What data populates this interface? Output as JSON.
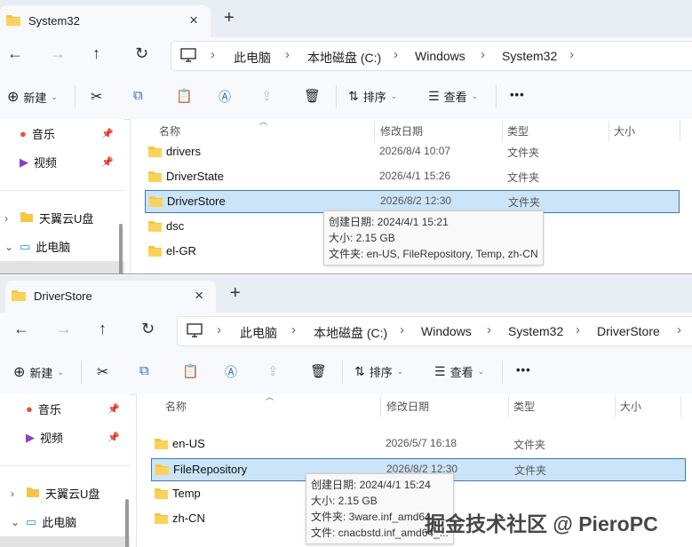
{
  "window1": {
    "tab_title": "System32",
    "tab_close": "×",
    "new_tab": "+",
    "breadcrumb": [
      "此电脑",
      "本地磁盘 (C:)",
      "Windows",
      "System32"
    ],
    "toolbar": {
      "new": "新建",
      "sort": "排序",
      "view": "查看",
      "more": "•••"
    },
    "sidebar": [
      {
        "label": "音乐",
        "icon": "music-icon",
        "pinned": true
      },
      {
        "label": "视频",
        "icon": "video-icon",
        "pinned": true
      },
      {
        "label": "天翼云U盘",
        "icon": "folder-icon",
        "expandable": true
      },
      {
        "label": "此电脑",
        "icon": "computer-icon",
        "expandable": true,
        "expanded": true
      }
    ],
    "columns": {
      "name": "名称",
      "modified": "修改日期",
      "type": "类型",
      "size": "大小"
    },
    "rows": [
      {
        "name": "drivers",
        "date": "2026/8/4 10:07",
        "type": "文件夹"
      },
      {
        "name": "DriverState",
        "date": "2026/4/1 15:26",
        "type": "文件夹"
      },
      {
        "name": "DriverStore",
        "date": "2026/8/2 12:30",
        "type": "文件夹",
        "selected": true
      },
      {
        "name": "dsc",
        "date": "",
        "type": ""
      },
      {
        "name": "el-GR",
        "date": "",
        "type": ""
      }
    ],
    "tooltip": [
      "创建日期: 2024/4/1 15:21",
      "大小: 2.15 GB",
      "文件夹: en-US, FileRepository, Temp, zh-CN"
    ]
  },
  "window2": {
    "tab_title": "DriverStore",
    "tab_close": "×",
    "new_tab": "+",
    "breadcrumb": [
      "此电脑",
      "本地磁盘 (C:)",
      "Windows",
      "System32",
      "DriverStore"
    ],
    "toolbar": {
      "new": "新建",
      "sort": "排序",
      "view": "查看",
      "more": "•••"
    },
    "sidebar": [
      {
        "label": "音乐",
        "icon": "music-icon",
        "pinned": true
      },
      {
        "label": "视频",
        "icon": "video-icon",
        "pinned": true
      },
      {
        "label": "天翼云U盘",
        "icon": "folder-icon",
        "expandable": true
      },
      {
        "label": "此电脑",
        "icon": "computer-icon",
        "expandable": true,
        "expanded": true
      }
    ],
    "columns": {
      "name": "名称",
      "modified": "修改日期",
      "type": "类型",
      "size": "大小"
    },
    "rows": [
      {
        "name": "en-US",
        "date": "2026/5/7 16:18",
        "type": "文件夹"
      },
      {
        "name": "FileRepository",
        "date": "2026/8/2 12:30",
        "type": "文件夹",
        "selected": true
      },
      {
        "name": "Temp",
        "date": "",
        "type": ""
      },
      {
        "name": "zh-CN",
        "date": "",
        "type": ""
      }
    ],
    "tooltip": [
      "创建日期: 2024/4/1 15:24",
      "大小: 2.15 GB",
      "文件夹: 3ware.inf_amd64_...",
      "文件: cnacbstd.inf_amd64_..."
    ]
  },
  "watermark": "掘金技术社区 @ PieroPC",
  "colors": {
    "accent": "#3c79b6",
    "selection": "#cce4f7",
    "folder": "#f6c544"
  }
}
